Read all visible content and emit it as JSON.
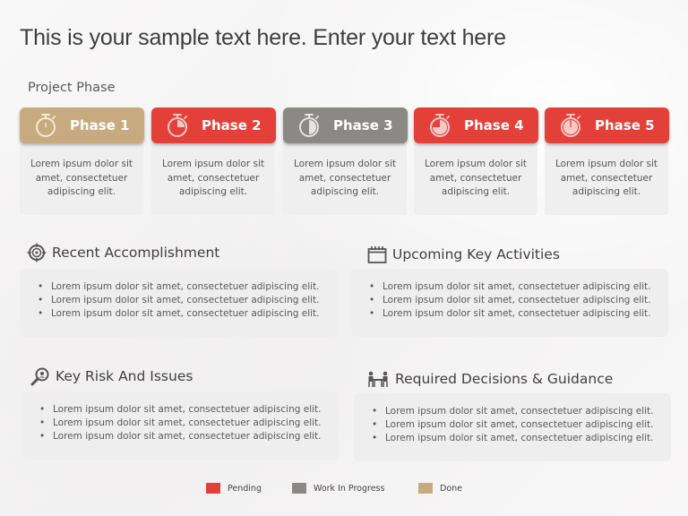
{
  "title": "This is your sample text here. Enter your text here",
  "subtitle": "Project Phase",
  "colors": {
    "pending": "#e3403a",
    "work_in_progress": "#8a8985",
    "done": "#c7aa80"
  },
  "phases": [
    {
      "label": "Phase 1",
      "status": "done",
      "color": "#c7aa80",
      "icon": "stopwatch-icon",
      "progress": 0.0,
      "text": "Lorem ipsum dolor sit amet, consectetuer adipiscing elit."
    },
    {
      "label": "Phase 2",
      "status": "pending",
      "color": "#e3403a",
      "icon": "stopwatch-icon",
      "progress": 0.25,
      "text": "Lorem ipsum dolor sit amet, consectetuer adipiscing elit."
    },
    {
      "label": "Phase 3",
      "status": "work_in_progress",
      "color": "#8a8985",
      "icon": "stopwatch-icon",
      "progress": 0.5,
      "text": "Lorem ipsum dolor sit amet, consectetuer adipiscing elit."
    },
    {
      "label": "Phase 4",
      "status": "pending",
      "color": "#e3403a",
      "icon": "stopwatch-icon",
      "progress": 0.75,
      "text": "Lorem ipsum dolor sit amet, consectetuer adipiscing elit."
    },
    {
      "label": "Phase 5",
      "status": "pending",
      "color": "#e3403a",
      "icon": "stopwatch-icon",
      "progress": 1.0,
      "text": "Lorem ipsum dolor sit amet, consectetuer adipiscing elit."
    }
  ],
  "sections": {
    "recent": {
      "title": "Recent Accomplishment",
      "icon": "target-icon",
      "items": [
        "Lorem ipsum dolor sit amet, consectetuer adipiscing elit.",
        "Lorem ipsum dolor sit amet, consectetuer adipiscing elit.",
        "Lorem ipsum dolor sit amet, consectetuer adipiscing elit."
      ]
    },
    "upcoming": {
      "title": "Upcoming Key Activities",
      "icon": "calendar-icon",
      "items": [
        "Lorem ipsum dolor sit amet, consectetuer adipiscing elit.",
        "Lorem ipsum dolor sit amet, consectetuer adipiscing elit.",
        "Lorem ipsum dolor sit amet, consectetuer adipiscing elit."
      ]
    },
    "risks": {
      "title": "Key Risk And Issues",
      "icon": "magnifier-icon",
      "items": [
        "Lorem ipsum dolor sit amet, consectetuer adipiscing elit.",
        "Lorem ipsum dolor sit amet, consectetuer adipiscing elit.",
        "Lorem ipsum dolor sit amet, consectetuer adipiscing elit."
      ]
    },
    "decisions": {
      "title": "Required Decisions & Guidance",
      "icon": "meeting-icon",
      "items": [
        "Lorem ipsum dolor sit amet, consectetuer adipiscing elit.",
        "Lorem ipsum dolor sit amet, consectetuer adipiscing elit.",
        "Lorem ipsum dolor sit amet, consectetuer adipiscing elit."
      ]
    }
  },
  "legend": [
    {
      "label": "Pending",
      "color": "#e3403a"
    },
    {
      "label": "Work In Progress",
      "color": "#8a8985"
    },
    {
      "label": "Done",
      "color": "#c7aa80"
    }
  ]
}
